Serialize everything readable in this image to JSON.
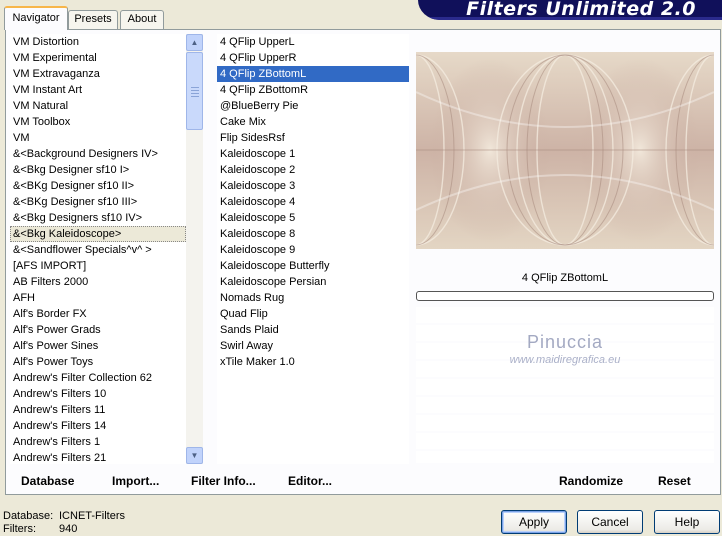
{
  "tabs": [
    {
      "label": "Navigator",
      "active": true
    },
    {
      "label": "Presets",
      "active": false
    },
    {
      "label": "About",
      "active": false
    }
  ],
  "banner": {
    "title": "Filters Unlimited 2.0"
  },
  "categories": {
    "items": [
      "VM Distortion",
      "VM Experimental",
      "VM Extravaganza",
      "VM Instant Art",
      "VM Natural",
      "VM Toolbox",
      "VM",
      "&<Background Designers IV>",
      "&<Bkg Designer sf10 I>",
      "&<BKg Designer sf10 II>",
      "&<BKg Designer sf10 III>",
      "&<Bkg Designers sf10 IV>",
      "&<Bkg Kaleidoscope>",
      "&<Sandflower Specials^v^ >",
      "[AFS IMPORT]",
      "AB Filters 2000",
      "AFH",
      "Alf's Border FX",
      "Alf's Power Grads",
      "Alf's Power Sines",
      "Alf's Power Toys",
      "Andrew's Filter Collection 62",
      "Andrew's Filters 10",
      "Andrew's Filters 11",
      "Andrew's Filters 14",
      "Andrew's Filters 1",
      "Andrew's Filters 21"
    ],
    "selected": "&<Bkg Kaleidoscope>"
  },
  "filters": {
    "items": [
      "4 QFlip UpperL",
      "4 QFlip UpperR",
      "4 QFlip ZBottomL",
      "4 QFlip ZBottomR",
      "@BlueBerry Pie",
      "Cake Mix",
      "Flip SidesRsf",
      "Kaleidoscope 1",
      "Kaleidoscope 2",
      "Kaleidoscope 3",
      "Kaleidoscope 4",
      "Kaleidoscope 5",
      "Kaleidoscope 8",
      "Kaleidoscope 9",
      "Kaleidoscope Butterfly",
      "Kaleidoscope Persian",
      "Nomads Rug",
      "Quad Flip",
      "Sands Plaid",
      "Swirl Away",
      "xTile Maker 1.0"
    ],
    "selected": "4 QFlip ZBottomL"
  },
  "preview": {
    "filter_name": "4 QFlip ZBottomL",
    "progress": 0,
    "watermark_name": "Pinuccia",
    "watermark_url": "www.maidiregrafica.eu"
  },
  "left_buttons": {
    "database": "Database",
    "import": "Import...",
    "filter_info": "Filter Info...",
    "editor": "Editor..."
  },
  "right_buttons": {
    "randomize": "Randomize",
    "reset": "Reset"
  },
  "status": {
    "database_label": "Database:",
    "database_value": "ICNET-Filters",
    "filters_label": "Filters:",
    "filters_value": "940"
  },
  "dialog_buttons": {
    "apply": "Apply",
    "cancel": "Cancel",
    "help": "Help"
  },
  "colors": {
    "selection": "#316ac5",
    "banner": "#10105a",
    "window_bg": "#ece9d8"
  }
}
